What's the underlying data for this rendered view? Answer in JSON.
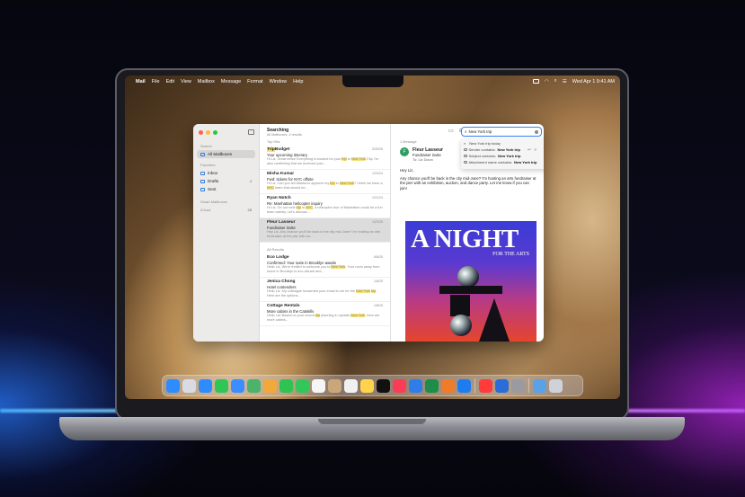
{
  "menubar": {
    "items": [
      "Mail",
      "File",
      "Edit",
      "View",
      "Mailbox",
      "Message",
      "Format",
      "Window",
      "Help"
    ],
    "clock": "Wed Apr 1  9:41 AM"
  },
  "toolbar": {
    "list_title": "Searching",
    "list_subtitle": "All Mailboxes, 4 results"
  },
  "search": {
    "query": "New York trip",
    "suggestions": [
      {
        "prefix": "",
        "value": "New York trip today"
      },
      {
        "prefix": "Sender contains: ",
        "value": "New York trip"
      },
      {
        "prefix": "Subject contains: ",
        "value": "New York trip"
      },
      {
        "prefix": "Attachment name contains: ",
        "value": "New York trip"
      }
    ]
  },
  "sidebar": {
    "sections": [
      "Search",
      "Favorites",
      "Smart Mailboxes",
      "iCloud"
    ],
    "all_mailboxes": "All Mailboxes",
    "items": [
      {
        "label": "Inbox",
        "count": ""
      },
      {
        "label": "Drafts",
        "count": "4"
      },
      {
        "label": "Sent",
        "count": ""
      }
    ],
    "icloud_count": "28"
  },
  "list": {
    "top_hits_label": "Top Hits",
    "all_results_label": "All Results",
    "top_hits": [
      {
        "from": "TripBudget",
        "date": "3/30/25",
        "subject": "Your upcoming itinerary",
        "preview": "Hi Liz, Great news! Everything is booked for your trip to New York City. I'm also confirming that we received your..."
      },
      {
        "from": "Misha Kumar",
        "date": "12/3/24",
        "subject": "Fwd: tickets for NYC offsite",
        "preview": "Hi Liz, Can you tell Marika to approve my trip to New York? I think we have a NYC team that should be..."
      },
      {
        "from": "Ryan Notch",
        "date": "12/1/24",
        "subject": "Re: Manhattan helicopter inquiry",
        "preview": "Hi Liz, On our next trip to NYC, a helicopter tour of Manhattan could be a fun team activity. Let's discuss..."
      },
      {
        "from": "Fleur Lasseur",
        "date": "1/23/25",
        "subject": "Fundraiser invite",
        "preview": "Hey Liz, Any chance you'll be back in the city mid-June? I'm hosting an arts fundraiser at the pier with an..."
      }
    ],
    "all_results": [
      {
        "from": "Eco Lodge",
        "date": "6/8/25",
        "subject": "Confirmed: Your suite in Brooklyn awaits",
        "preview": "Hello Liz, We're thrilled to welcome you to New York. Your room away from home in Brooklyn is eco-vibrant and..."
      },
      {
        "from": "Jenica Chong",
        "date": "1/8/25",
        "subject": "Hotel contenders",
        "preview": "Hello Liz, My colleague forwarded your email to me for the New York trip. Here are the options..."
      },
      {
        "from": "Cottage Rentals",
        "date": "1/8/25",
        "subject": "More cabins in the Catskills",
        "preview": "Hello Liz! Based on your recent trip planning in upstate New York, here are more cabins..."
      }
    ]
  },
  "reader": {
    "count": "1 Message",
    "avatar": "F",
    "from": "Fleur Lasseur",
    "subject": "Fundraiser invite",
    "to": "To:  Liz Dizon",
    "greeting": "Hey Liz,",
    "body": "Any chance you'll be back in the city mid-June? I'm hosting an arts fundraiser at the pier with an exhibition, auction, and dance party. Let me know if you can join!",
    "poster_title": "A NIGHT",
    "poster_sub": "FOR THE ARTS"
  },
  "dock": {
    "apps": [
      "finder-icon",
      "launchpad-icon",
      "safari-icon",
      "messages-icon",
      "mail-icon",
      "maps-icon",
      "photos-icon",
      "facetime-icon",
      "phone-icon",
      "calendar-icon",
      "contacts-icon",
      "reminders-icon",
      "notes-icon",
      "tv-icon",
      "music-icon",
      "keynote-icon",
      "numbers-icon",
      "pages-icon",
      "app-store-icon",
      "news-icon",
      "xcode-icon",
      "settings-icon"
    ],
    "colors": [
      "#2d8cff",
      "#d9dbe3",
      "#2f8cff",
      "#30c655",
      "#3c8dff",
      "#4bb36c",
      "#f2a83a",
      "#2fc352",
      "#33c75a",
      "#f5f5f5",
      "#c9a77a",
      "#f1f1f1",
      "#ffd34a",
      "#111111",
      "#fa3d56",
      "#2f7de8",
      "#1d8d47",
      "#f07b2a",
      "#1e7cf2",
      "#ff3b3b",
      "#2a6cd8",
      "#9a9aa0"
    ]
  }
}
